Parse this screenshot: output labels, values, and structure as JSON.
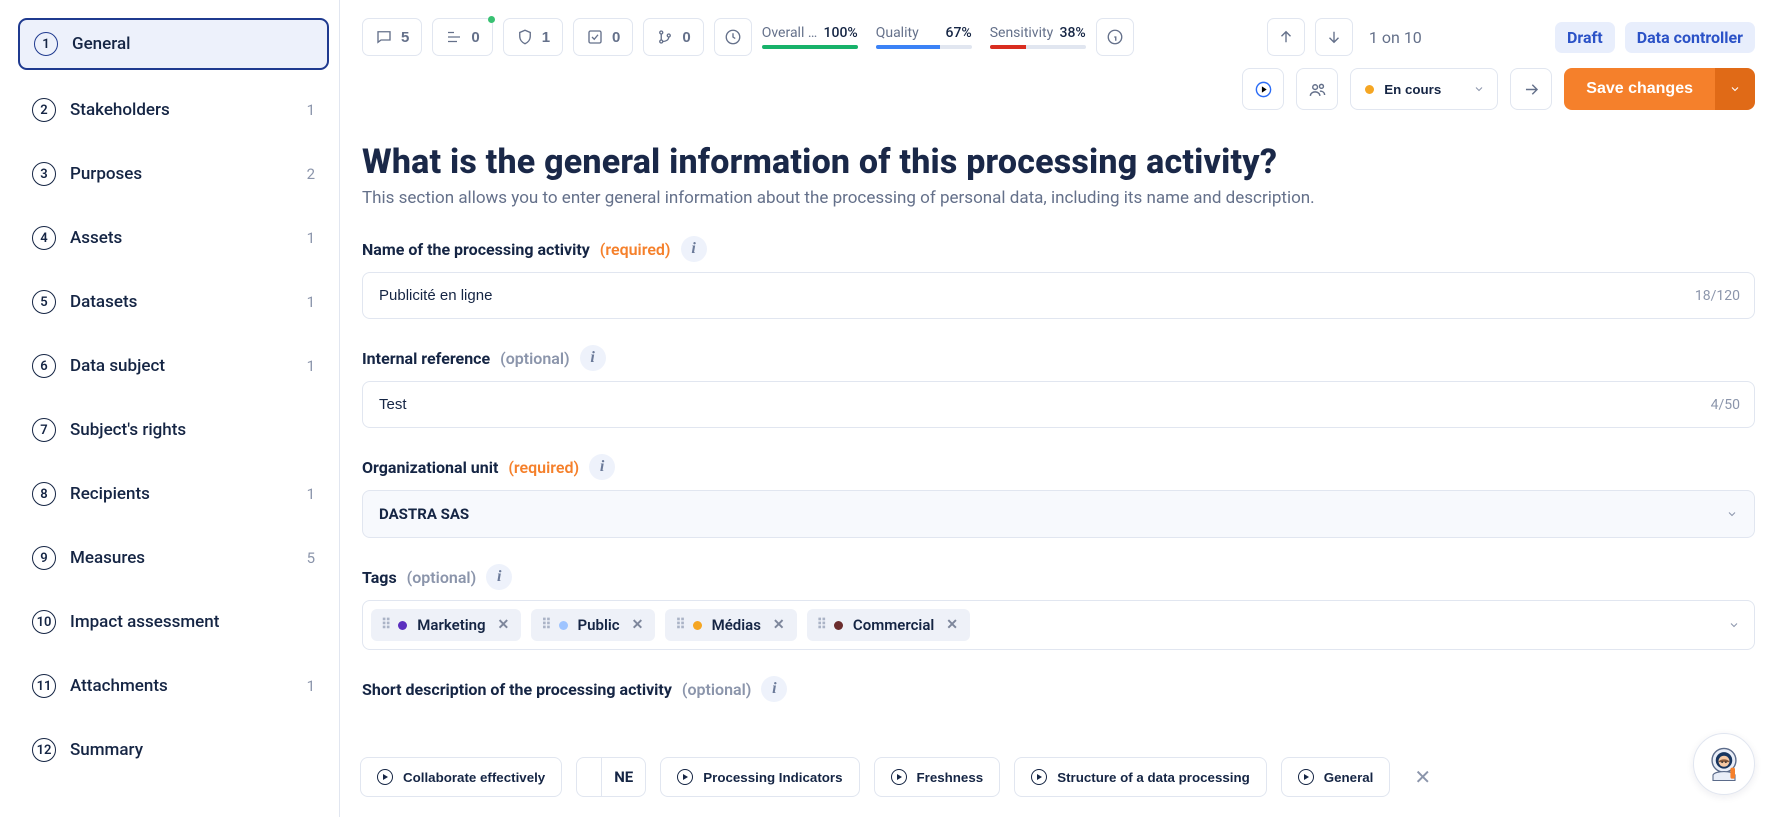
{
  "sidebar": {
    "steps": [
      {
        "num": "1",
        "label": "General",
        "count": "",
        "active": true
      },
      {
        "num": "2",
        "label": "Stakeholders",
        "count": "1"
      },
      {
        "num": "3",
        "label": "Purposes",
        "count": "2"
      },
      {
        "num": "4",
        "label": "Assets",
        "count": "1"
      },
      {
        "num": "5",
        "label": "Datasets",
        "count": "1"
      },
      {
        "num": "6",
        "label": "Data subject",
        "count": "1"
      },
      {
        "num": "7",
        "label": "Subject's rights",
        "count": ""
      },
      {
        "num": "8",
        "label": "Recipients",
        "count": "1"
      },
      {
        "num": "9",
        "label": "Measures",
        "count": "5"
      },
      {
        "num": "10",
        "label": "Impact assessment",
        "count": ""
      },
      {
        "num": "11",
        "label": "Attachments",
        "count": "1"
      },
      {
        "num": "12",
        "label": "Summary",
        "count": ""
      }
    ]
  },
  "topbar": {
    "comments": "5",
    "list": "0",
    "shield": "1",
    "tasks": "0",
    "branches": "0",
    "metrics": {
      "overall": {
        "label": "Overall …",
        "value": "100%"
      },
      "quality": {
        "label": "Quality",
        "value": "67%"
      },
      "sensitivity": {
        "label": "Sensitivity",
        "value": "38%"
      }
    },
    "pagination": "1 on 10",
    "draft": "Draft",
    "role": "Data controller",
    "status": "En cours",
    "save": "Save changes"
  },
  "form": {
    "title": "What is the general information of this processing activity?",
    "subtitle": "This section allows you to enter general information about the processing of personal data, including its name and description.",
    "name_label": "Name of the processing activity",
    "required": "(required)",
    "optional": "(optional)",
    "name_value": "Publicité en ligne",
    "name_counter": "18/120",
    "ref_label": "Internal reference",
    "ref_value": "Test",
    "ref_counter": "4/50",
    "org_label": "Organizational unit",
    "org_value": "DASTRA SAS",
    "tags_label": "Tags",
    "tags": [
      {
        "label": "Marketing",
        "color": "#5b2fbf"
      },
      {
        "label": "Public",
        "color": "#9ec4ff"
      },
      {
        "label": "Médias",
        "color": "#f5a623"
      },
      {
        "label": "Commercial",
        "color": "#6b2d2d"
      }
    ],
    "desc_label": "Short description of the processing activity"
  },
  "tray": {
    "collab": "Collaborate effectively",
    "frag": "NE",
    "indicators": "Processing Indicators",
    "freshness": "Freshness",
    "structure": "Structure of a data processing",
    "general": "General"
  }
}
